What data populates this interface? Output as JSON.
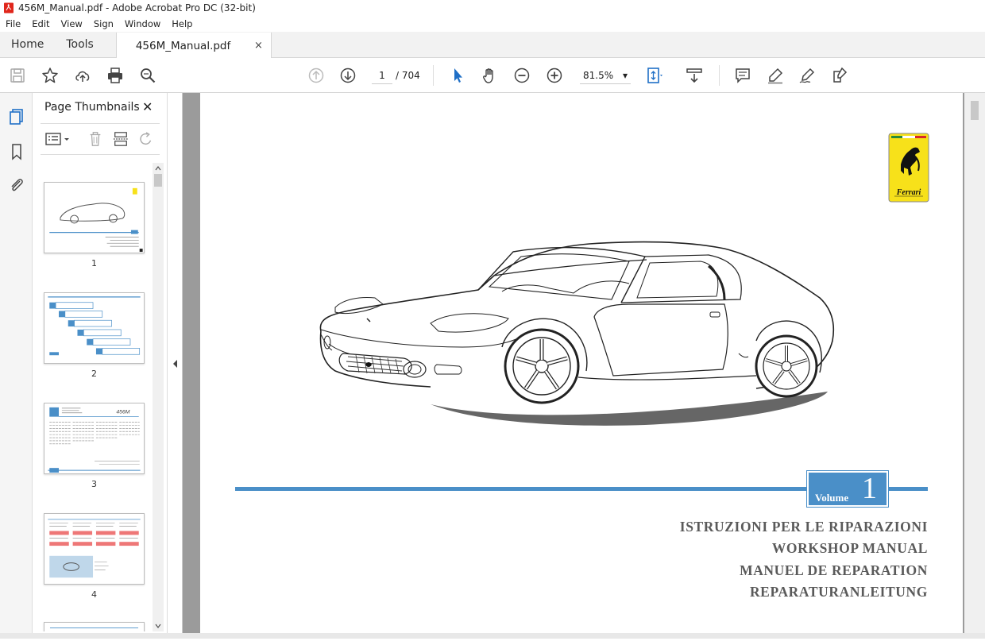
{
  "window": {
    "title": "456M_Manual.pdf - Adobe Acrobat Pro DC (32-bit)"
  },
  "menu": [
    "File",
    "Edit",
    "View",
    "Sign",
    "Window",
    "Help"
  ],
  "tabs": {
    "home": "Home",
    "tools": "Tools",
    "document": "456M_Manual.pdf",
    "close": "×"
  },
  "toolbar": {
    "current_page": "1",
    "page_total": "/ 704",
    "zoom": "81.5%",
    "zoom_caret": "▾"
  },
  "panel": {
    "title": "Page Thumbnails",
    "close": "✕",
    "thumbnails": [
      {
        "label": "1"
      },
      {
        "label": "2"
      },
      {
        "label": "3"
      },
      {
        "label": "4"
      }
    ]
  },
  "thumb3": {
    "model": "456M"
  },
  "document": {
    "logo_text": "Ferrari",
    "volume_label": "Volume",
    "volume_number": "1",
    "headings": [
      "ISTRUZIONI PER LE RIPARAZIONI",
      "WORKSHOP MANUAL",
      "MANUEL DE REPARATION",
      "REPARATURANLEITUNG"
    ]
  },
  "colors": {
    "accent_blue": "#4a8fc8",
    "acrobat_red": "#e0261b",
    "ferrari_yellow": "#f7e11a",
    "viewer_gray": "#9b9b9b"
  },
  "icons": [
    "save-icon",
    "bookmark-star-icon",
    "upload-cloud-icon",
    "print-icon",
    "search-icon",
    "page-up-icon",
    "page-down-icon",
    "select-arrow-icon",
    "hand-icon",
    "zoom-out-icon",
    "zoom-in-icon",
    "fit-page-icon",
    "scroll-mode-icon",
    "comment-icon",
    "highlight-icon",
    "sign-icon",
    "fill-sign-icon"
  ]
}
